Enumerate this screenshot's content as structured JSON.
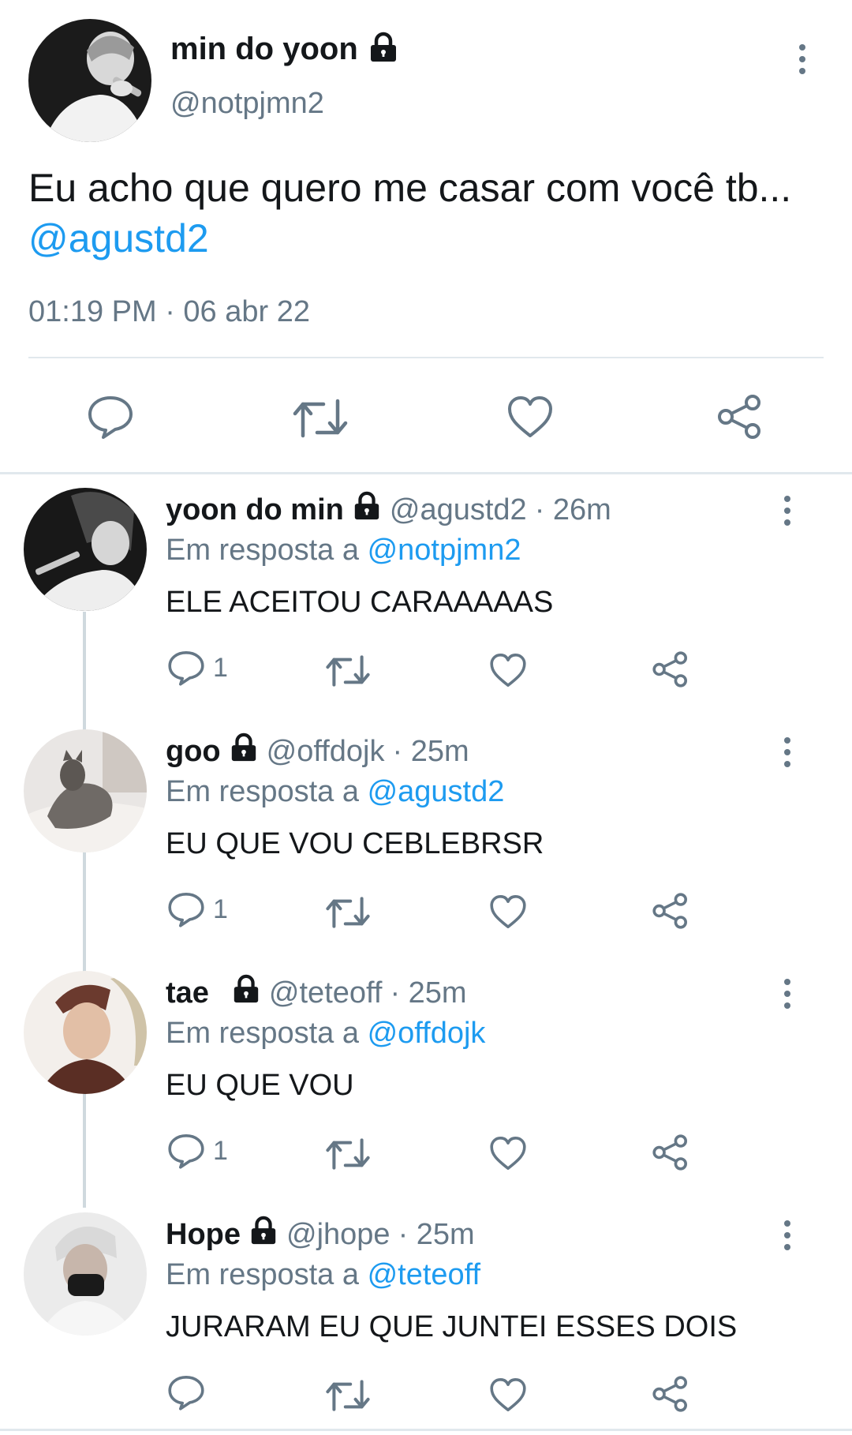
{
  "main_tweet": {
    "display_name": "min do yoon",
    "handle": "@notpjmn2",
    "text": "Eu acho que quero me casar com você tb...",
    "mention": "@agustd2",
    "timestamp": "01:19 PM · 06 abr 22",
    "icons": [
      "reply-icon",
      "retweet-icon",
      "like-icon",
      "share-icon",
      "more-icon",
      "lock-icon"
    ]
  },
  "replies": [
    {
      "display_name": "yoon do min",
      "handle": "@agustd2",
      "time": "· 26m",
      "reply_to_label": "Em resposta a",
      "reply_to_handle": "@notpjmn2",
      "text": "ELE ACEITOU CARAAAAAS",
      "reply_count": "1"
    },
    {
      "display_name": "goo",
      "handle": "@offdojk",
      "time": "· 25m",
      "reply_to_label": "Em resposta a",
      "reply_to_handle": "@agustd2",
      "text": "EU QUE VOU CEBLEBRSR",
      "reply_count": "1"
    },
    {
      "display_name": "tae",
      "handle": "@teteoff",
      "time": "· 25m",
      "reply_to_label": "Em resposta a",
      "reply_to_handle": "@offdojk",
      "text": "EU QUE VOU",
      "reply_count": "1"
    },
    {
      "display_name": "Hope",
      "handle": "@jhope",
      "time": "· 25m",
      "reply_to_label": "Em resposta a",
      "reply_to_handle": "@teteoff",
      "text": "JURARAM EU QUE JUNTEI ESSES DOIS",
      "reply_count": ""
    }
  ],
  "colors": {
    "link": "#1d9bf0",
    "muted": "#657786",
    "divider": "#e1e8ed"
  }
}
